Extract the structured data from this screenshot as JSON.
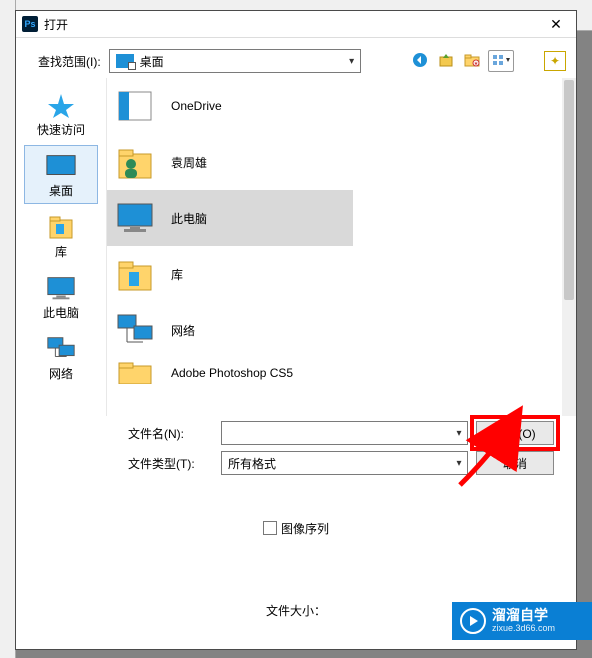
{
  "titlebar": {
    "title": "打开"
  },
  "toolbar": {
    "look_in_label": "查找范围(I):",
    "location": "桌面"
  },
  "places": [
    {
      "key": "quick",
      "label": "快速访问"
    },
    {
      "key": "desktop",
      "label": "桌面",
      "selected": true
    },
    {
      "key": "lib",
      "label": "库"
    },
    {
      "key": "pc",
      "label": "此电脑"
    },
    {
      "key": "net",
      "label": "网络"
    }
  ],
  "files": [
    {
      "key": "onedrive",
      "label": "OneDrive"
    },
    {
      "key": "user",
      "label": "袁周雄"
    },
    {
      "key": "pc",
      "label": "此电脑",
      "selected": true
    },
    {
      "key": "lib",
      "label": "库"
    },
    {
      "key": "net",
      "label": "网络"
    },
    {
      "key": "ps",
      "label": "Adobe Photoshop CS5"
    }
  ],
  "form": {
    "filename_label": "文件名(N):",
    "filename_value": "",
    "filetype_label": "文件类型(T):",
    "filetype_value": "所有格式",
    "open_btn": "打开(O)",
    "cancel_btn": "取消",
    "seq_checkbox": "图像序列",
    "filesize_label": "文件大小："
  },
  "watermark": {
    "brand": "溜溜自学",
    "url": "zixue.3d66.com"
  }
}
